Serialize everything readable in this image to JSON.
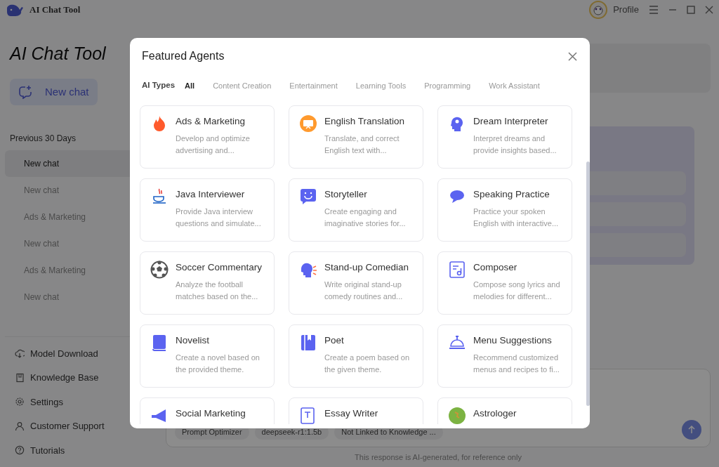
{
  "titlebar": {
    "app_name": "AI Chat Tool",
    "profile": "Profile"
  },
  "sidebar": {
    "title": "AI Chat Tool",
    "new_chat": "New chat",
    "section": "Previous 30 Days",
    "chats": [
      {
        "label": "New chat",
        "selected": true
      },
      {
        "label": "New chat",
        "selected": false
      },
      {
        "label": "Ads & Marketing",
        "selected": false
      },
      {
        "label": "New chat",
        "selected": false
      },
      {
        "label": "Ads & Marketing",
        "selected": false
      },
      {
        "label": "New chat",
        "selected": false
      }
    ],
    "nav": [
      "Model Download",
      "Knowledge Base",
      "Settings",
      "Customer Support",
      "Tutorials"
    ]
  },
  "composer": {
    "chips": [
      "Prompt Optimizer",
      "deepseek-r1:1.5b",
      "Not Linked to Knowledge ..."
    ],
    "disclaimer": "This response is AI-generated, for reference only"
  },
  "modal": {
    "title": "Featured Agents",
    "filter_label": "AI Types",
    "tabs": [
      {
        "label": "All",
        "selected": true
      },
      {
        "label": "Content Creation",
        "selected": false
      },
      {
        "label": "Entertainment",
        "selected": false
      },
      {
        "label": "Learning Tools",
        "selected": false
      },
      {
        "label": "Programming",
        "selected": false
      },
      {
        "label": "Work Assistant",
        "selected": false
      }
    ],
    "agents": [
      {
        "name": "Ads & Marketing",
        "description": "Develop and optimize advertising and..."
      },
      {
        "name": "English Translation",
        "description": "Translate, and correct English text with..."
      },
      {
        "name": "Dream Interpreter",
        "description": "Interpret dreams and provide insights based..."
      },
      {
        "name": "Java Interviewer",
        "description": "Provide Java interview questions and simulate..."
      },
      {
        "name": "Storyteller",
        "description": "Create engaging and imaginative stories for..."
      },
      {
        "name": "Speaking Practice",
        "description": "Practice your spoken English with interactive..."
      },
      {
        "name": "Soccer Commentary",
        "description": "Analyze the football matches based on the..."
      },
      {
        "name": "Stand-up Comedian",
        "description": "Write original stand-up comedy routines and..."
      },
      {
        "name": "Composer",
        "description": "Compose song lyrics and melodies for different..."
      },
      {
        "name": "Novelist",
        "description": "Create a novel based on the provided theme."
      },
      {
        "name": "Poet",
        "description": "Create a poem based on the given theme."
      },
      {
        "name": "Menu Suggestions",
        "description": "Recommend customized menus and recipes to fi..."
      },
      {
        "name": "Social Marketing"
      },
      {
        "name": "Essay Writer"
      },
      {
        "name": "Astrologer"
      }
    ]
  }
}
